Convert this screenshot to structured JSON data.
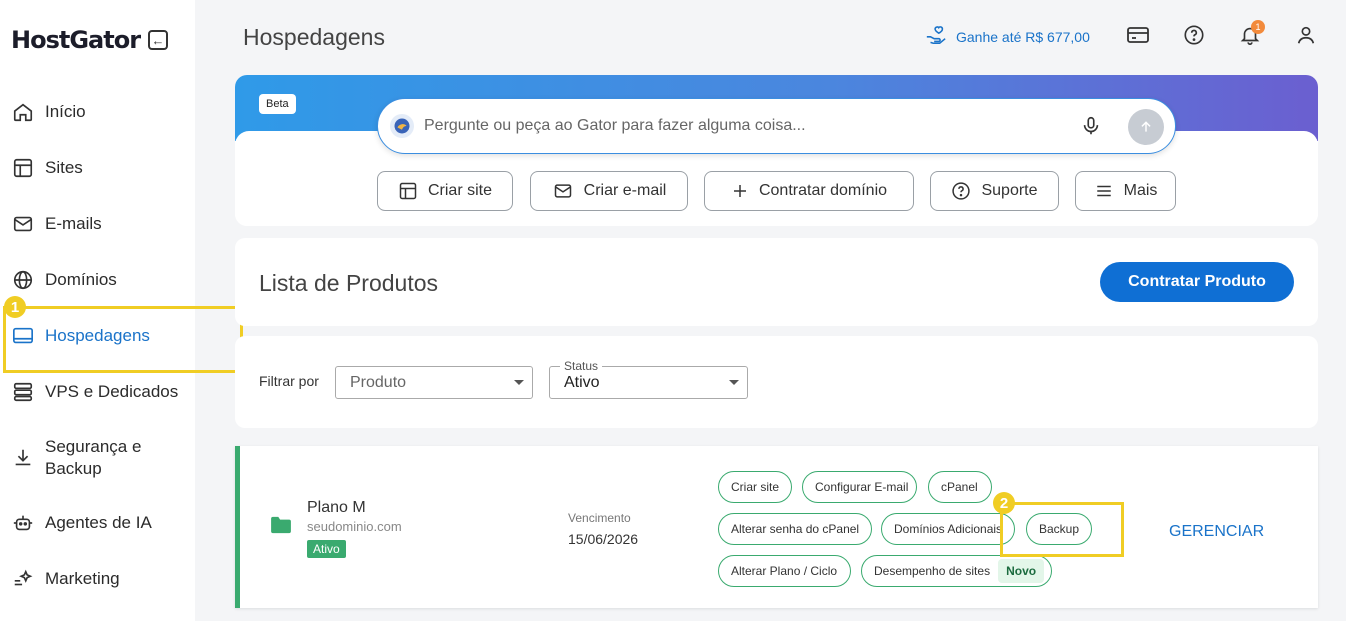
{
  "sidebar": {
    "logo": "HostGator",
    "items": [
      {
        "label": "Início",
        "icon": "home-icon"
      },
      {
        "label": "Sites",
        "icon": "layout-icon"
      },
      {
        "label": "E-mails",
        "icon": "mail-icon"
      },
      {
        "label": "Domínios",
        "icon": "globe-icon"
      },
      {
        "label": "Hospedagens",
        "icon": "laptop-icon",
        "active": true
      },
      {
        "label": "VPS e Dedicados",
        "icon": "server-icon"
      },
      {
        "label": "Segurança e Backup",
        "icon": "download-icon"
      },
      {
        "label": "Agentes de IA",
        "icon": "robot-icon"
      },
      {
        "label": "Marketing",
        "icon": "sparkle-icon"
      }
    ]
  },
  "annotations": {
    "step1": "1",
    "step2": "2"
  },
  "header": {
    "title": "Hospedagens",
    "earn_label": "Ganhe até R$ 677,00",
    "notifications": "1"
  },
  "ai": {
    "beta": "Beta",
    "placeholder": "Pergunte ou peça ao Gator para fazer alguma coisa...",
    "chips": [
      "Criar site",
      "Criar e-mail",
      "Contratar domínio",
      "Suporte",
      "Mais"
    ]
  },
  "products": {
    "title": "Lista de Produtos",
    "cta": "Contratar Produto"
  },
  "filter": {
    "label": "Filtrar por",
    "product_placeholder": "Produto",
    "status_legend": "Status",
    "status_value": "Ativo"
  },
  "plan": {
    "name": "Plano M",
    "domain": "seudominio.com",
    "status": "Ativo",
    "due_label": "Vencimento",
    "due_date": "15/06/2026",
    "actions": [
      "Criar site",
      "Configurar E-mail",
      "cPanel",
      "Alterar senha do cPanel",
      "Domínios Adicionais",
      "Backup",
      "Alterar Plano / Ciclo",
      "Desempenho de sites"
    ],
    "new_badge": "Novo",
    "manage": "GERENCIAR"
  },
  "colors": {
    "accent": "#1a73c9",
    "primary_button": "#0f6fd4",
    "success": "#3aaa6f",
    "highlight": "#f0cd24"
  }
}
